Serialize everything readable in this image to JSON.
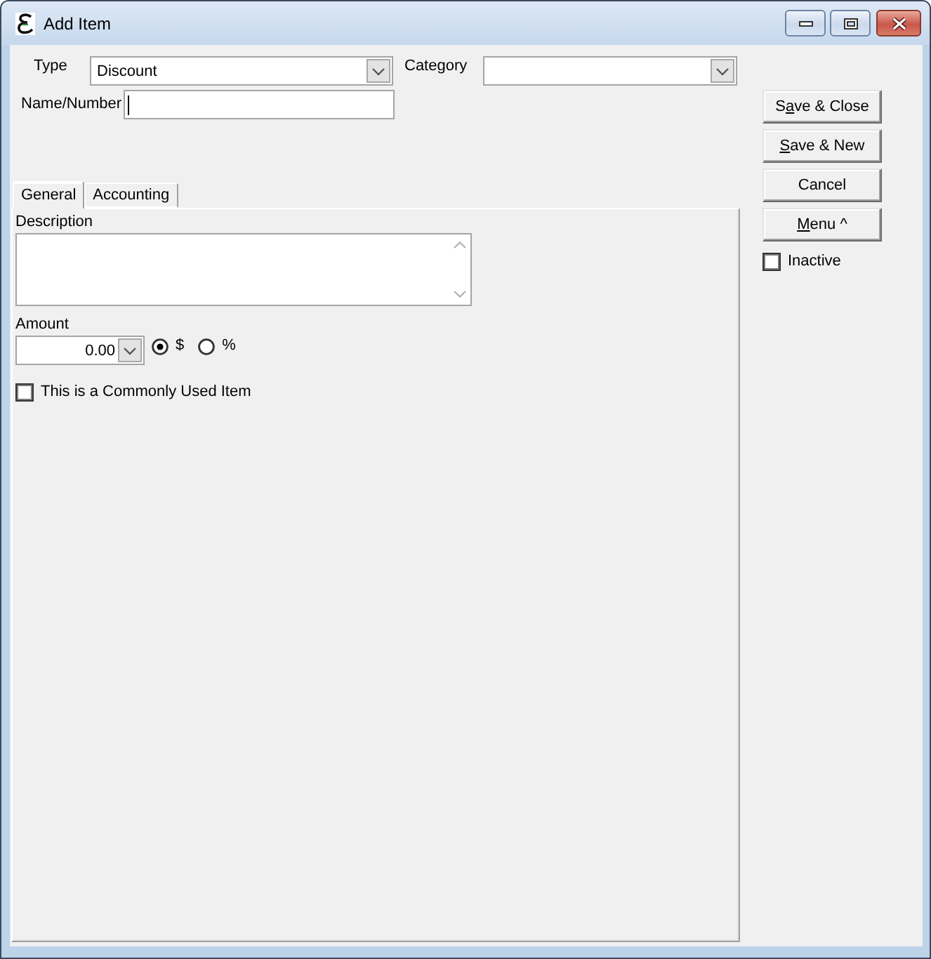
{
  "window": {
    "title": "Add Item"
  },
  "fields": {
    "type": {
      "label": "Type",
      "value": "Discount"
    },
    "category": {
      "label": "Category"
    },
    "name_number": {
      "label": "Name/Number",
      "focused": true
    }
  },
  "buttons": [
    {
      "label_before": "S",
      "access_key": "a",
      "label_after": "ve & Close"
    },
    {
      "access_key": "S",
      "label_after": "ave & New"
    },
    {
      "label_before": "Cancel"
    },
    {
      "access_key": "M",
      "label_after": "enu ^"
    }
  ],
  "inactive": {
    "label": "Inactive",
    "checked": false
  },
  "tabs": [
    {
      "label": "General",
      "selected": true
    },
    {
      "label": "Accounting",
      "selected": false
    }
  ],
  "general": {
    "description": {
      "label": "Description"
    },
    "amount": {
      "label": "Amount",
      "value": "0.00"
    },
    "amount_unit": [
      {
        "label": "$",
        "selected": true
      },
      {
        "label": "%",
        "selected": false
      }
    ],
    "commonly_used": {
      "label": "This is a Commonly Used Item",
      "checked": false
    }
  }
}
